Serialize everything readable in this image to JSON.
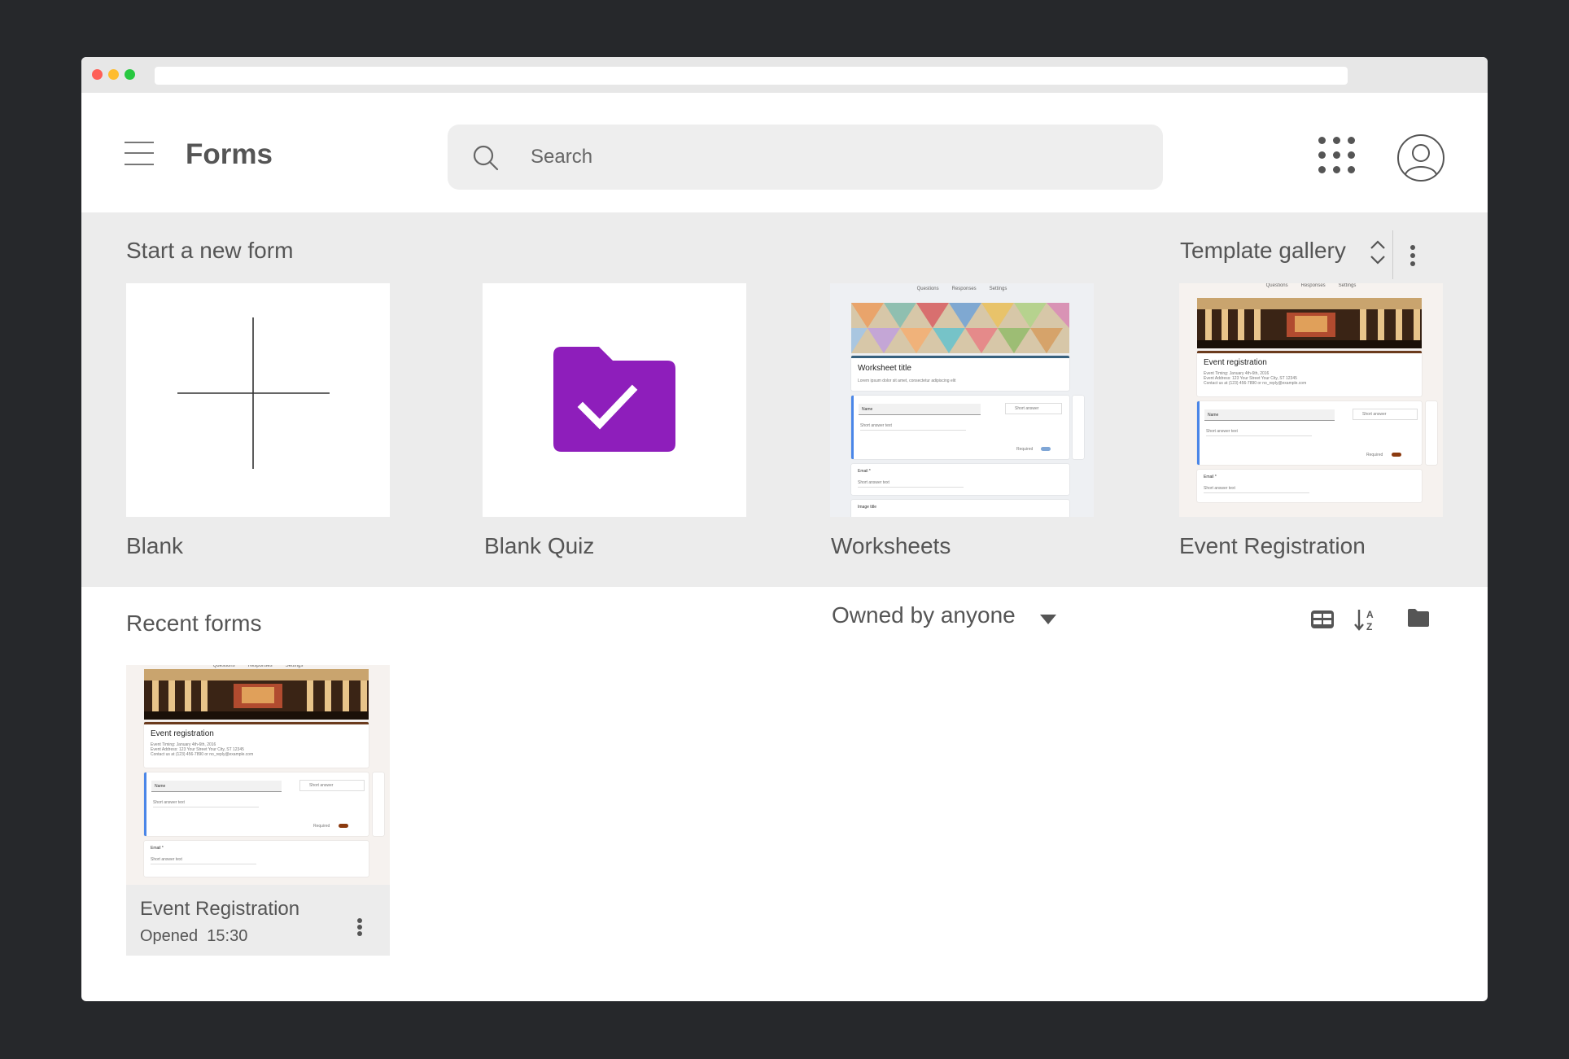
{
  "header": {
    "app_title": "Forms",
    "search_placeholder": "Search"
  },
  "start_section": {
    "title": "Start a new form",
    "template_gallery_label": "Template gallery",
    "templates": [
      {
        "label": "Blank",
        "icon": "plus-icon"
      },
      {
        "label": "Blank Quiz",
        "icon": "quiz-folder-check-icon",
        "color": "#8e1ebb"
      },
      {
        "label": "Worksheets",
        "icon": "worksheet-preview"
      },
      {
        "label": "Event Registration",
        "icon": "event-registration-preview"
      }
    ],
    "worksheet_preview": {
      "tabs": [
        "Questions",
        "Responses",
        "Settings"
      ],
      "title": "Worksheet title",
      "description": "Lorem ipsum dolor sit amet, consectetur adipiscing elit",
      "question": "Name",
      "answer_type": "Short answer",
      "short_answer_text": "Short answer text",
      "required_label": "Required",
      "email_label": "Email *",
      "image_title": "Image title"
    },
    "event_preview": {
      "tabs": [
        "Questions",
        "Responses",
        "Settings"
      ],
      "title": "Event registration",
      "details": [
        "Event Timing: January 4th-6th, 2016",
        "Event Address: 123 Your Street Your City, ST 12345",
        "Contact us at (123) 456-7890 or no_reply@example.com"
      ],
      "question": "Name",
      "answer_type": "Short answer",
      "short_answer_text": "Short answer text",
      "required_label": "Required",
      "email_label": "Email *"
    }
  },
  "recent_section": {
    "title": "Recent forms",
    "owner_filter": "Owned by anyone",
    "view_icons": [
      "list-view-icon",
      "sort-az-icon",
      "folder-icon"
    ],
    "forms": [
      {
        "name": "Event Registration",
        "opened_label": "Opened",
        "opened_time": "15:30"
      }
    ]
  },
  "colors": {
    "quiz_purple": "#8e1ebb",
    "section_bg": "#ececec",
    "accent_blue": "#4a86e8"
  }
}
